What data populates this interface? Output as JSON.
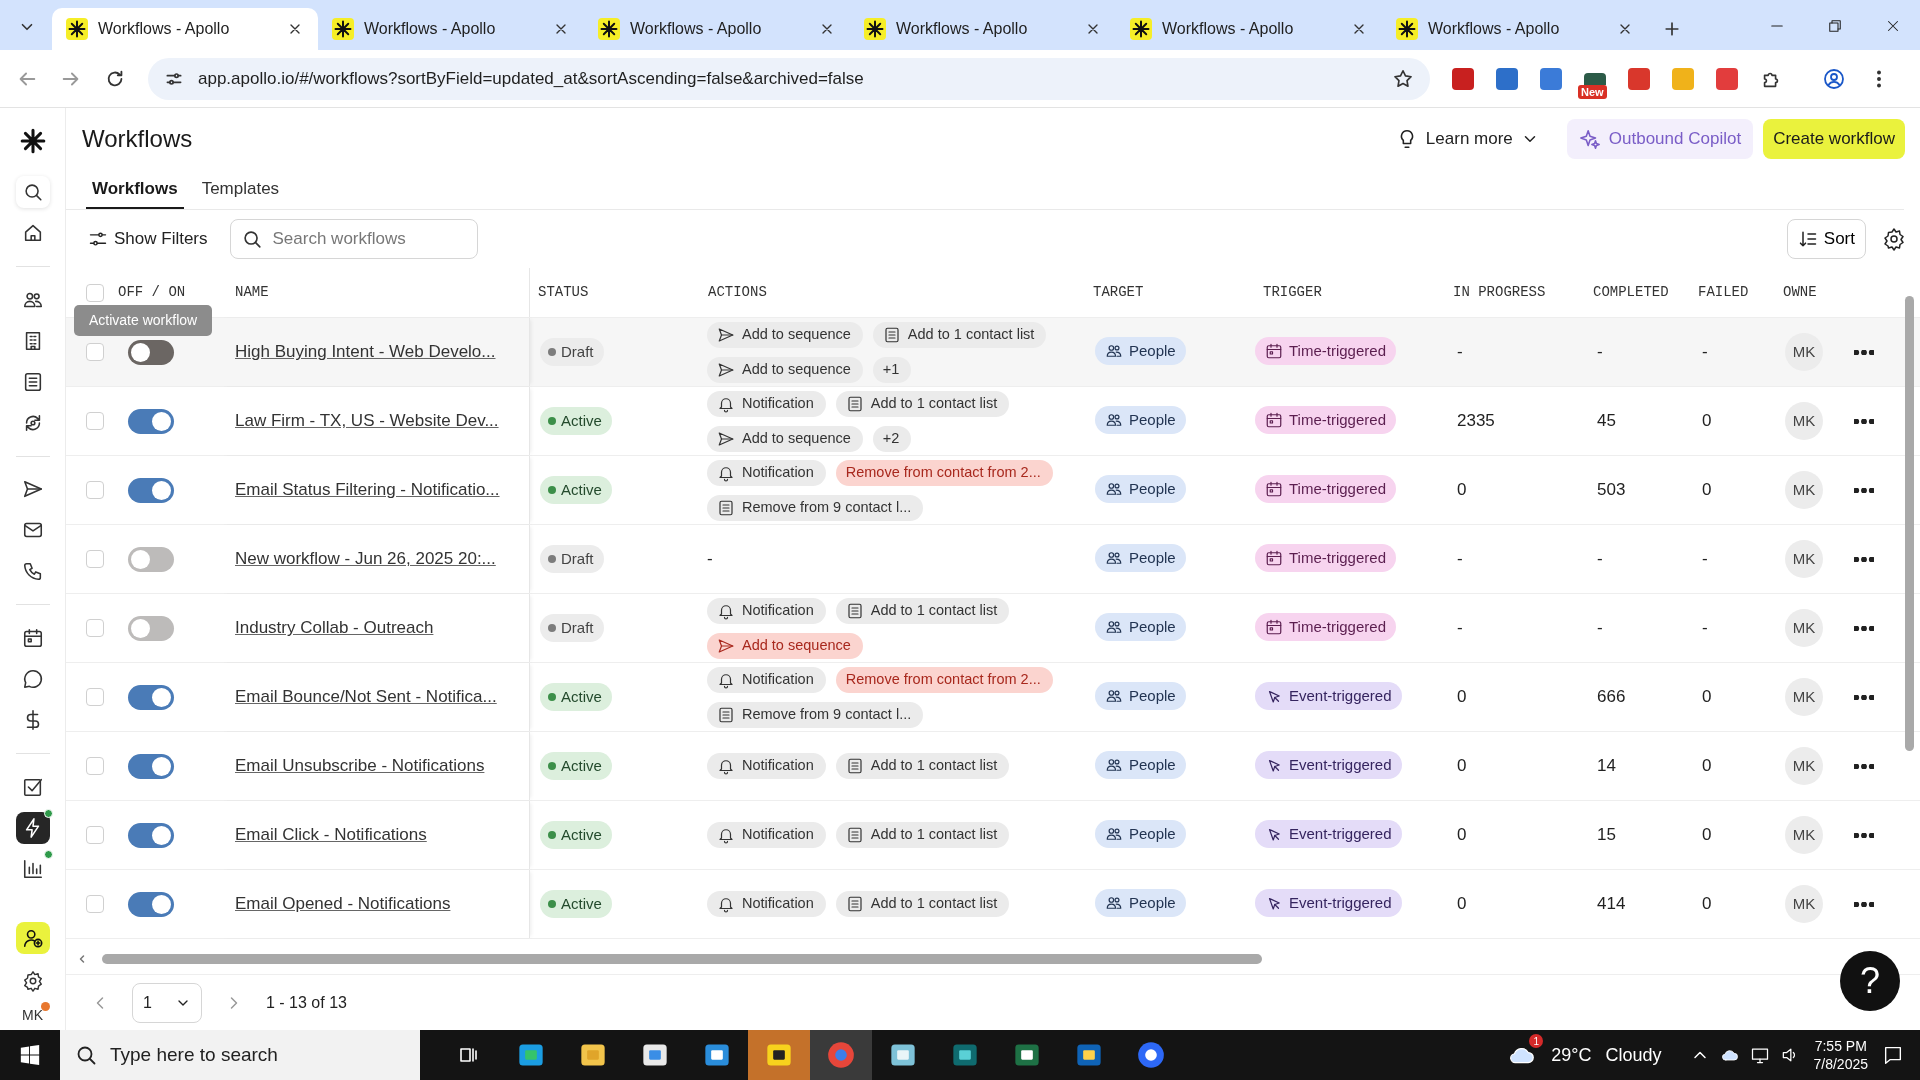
{
  "browser": {
    "tabs": [
      {
        "title": "Workflows - Apollo",
        "selected": true
      },
      {
        "title": "Workflows - Apollo",
        "selected": false
      },
      {
        "title": "Workflows - Apollo",
        "selected": false
      },
      {
        "title": "Workflows - Apollo",
        "selected": false
      },
      {
        "title": "Workflows - Apollo",
        "selected": false
      },
      {
        "title": "Workflows - Apollo",
        "selected": false
      }
    ],
    "url": "app.apollo.io/#/workflows?sortByField=updated_at&sortAscending=false&archived=false",
    "extension_badge": "New"
  },
  "sidebar": {
    "items": [
      {
        "selected": false,
        "dot": false
      },
      {
        "selected": false,
        "dot": false
      },
      {
        "selected": false,
        "dot": false
      },
      {
        "selected": false,
        "dot": false
      },
      {
        "selected": false,
        "dot": false
      },
      {
        "selected": false,
        "dot": false
      },
      {
        "selected": false,
        "dot": false
      },
      {
        "selected": false,
        "dot": false
      },
      {
        "selected": false,
        "dot": false
      },
      {
        "selected": false,
        "dot": false
      },
      {
        "selected": false,
        "dot": false
      },
      {
        "selected": false,
        "dot": false
      },
      {
        "selected": false,
        "dot": false
      },
      {
        "selected": true,
        "dot": true
      },
      {
        "selected": false,
        "dot": true
      }
    ],
    "avatar": {
      "initials": "MK",
      "dot": true
    }
  },
  "header": {
    "title": "Workflows",
    "learn_more": "Learn more",
    "copilot": "Outbound Copilot",
    "create": "Create workflow"
  },
  "tabs": [
    {
      "label": "Workflows",
      "selected": true
    },
    {
      "label": "Templates",
      "selected": false
    }
  ],
  "toolbar": {
    "filters": "Show Filters",
    "search": {
      "placeholder": "Search workflows"
    },
    "sort": "Sort"
  },
  "tooltip": "Activate workflow",
  "table": {
    "select_all": {
      "checked": false
    },
    "columns": [
      "OFF / ON",
      "NAME",
      "STATUS",
      "ACTIONS",
      "TARGET",
      "TRIGGER",
      "IN PROGRESS",
      "COMPLETED",
      "FAILED",
      "OWNE"
    ],
    "rows": [
      {
        "checked": false,
        "on": false,
        "hovered": true,
        "name": "High Buying Intent - Web Develo...",
        "status": {
          "label": "Draft",
          "kind": "draft"
        },
        "actions": [
          [
            {
              "kind": "sequence",
              "label": "Add to sequence",
              "alert": false
            },
            {
              "kind": "list",
              "label": "Add to 1 contact list",
              "alert": false
            }
          ],
          [
            {
              "kind": "sequence",
              "label": "Add to sequence",
              "alert": false
            },
            {
              "kind": "more",
              "label": "+1",
              "alert": false
            }
          ]
        ],
        "target": "People",
        "trigger": {
          "label": "Time-triggered",
          "kind": "time"
        },
        "in_progress": "-",
        "completed": "-",
        "failed": "-",
        "owner": "MK"
      },
      {
        "checked": false,
        "on": true,
        "hovered": false,
        "name": "Law Firm - TX, US - Website Dev...",
        "status": {
          "label": "Active",
          "kind": "active"
        },
        "actions": [
          [
            {
              "kind": "notification",
              "label": "Notification",
              "alert": false
            },
            {
              "kind": "list",
              "label": "Add to 1 contact list",
              "alert": false
            }
          ],
          [
            {
              "kind": "sequence",
              "label": "Add to sequence",
              "alert": false
            },
            {
              "kind": "more",
              "label": "+2",
              "alert": false
            }
          ]
        ],
        "target": "People",
        "trigger": {
          "label": "Time-triggered",
          "kind": "time"
        },
        "in_progress": "2335",
        "completed": "45",
        "failed": "0",
        "owner": "MK"
      },
      {
        "checked": false,
        "on": true,
        "hovered": false,
        "name": "Email Status Filtering - Notificatio...",
        "status": {
          "label": "Active",
          "kind": "active"
        },
        "actions": [
          [
            {
              "kind": "notification",
              "label": "Notification",
              "alert": false
            },
            {
              "kind": "plain",
              "label": "Remove from contact from 2...",
              "alert": true
            }
          ],
          [
            {
              "kind": "list",
              "label": "Remove from 9 contact l...",
              "alert": false
            }
          ]
        ],
        "target": "People",
        "trigger": {
          "label": "Time-triggered",
          "kind": "time"
        },
        "in_progress": "0",
        "completed": "503",
        "failed": "0",
        "owner": "MK"
      },
      {
        "checked": false,
        "on": false,
        "hovered": false,
        "name": "New workflow - Jun 26, 2025 20:...",
        "status": {
          "label": "Draft",
          "kind": "draft"
        },
        "actions_empty": "-",
        "target": "People",
        "trigger": {
          "label": "Time-triggered",
          "kind": "time"
        },
        "in_progress": "-",
        "completed": "-",
        "failed": "-",
        "owner": "MK"
      },
      {
        "checked": false,
        "on": false,
        "hovered": false,
        "name": "Industry Collab - Outreach",
        "status": {
          "label": "Draft",
          "kind": "draft"
        },
        "actions": [
          [
            {
              "kind": "notification",
              "label": "Notification",
              "alert": false
            },
            {
              "kind": "list",
              "label": "Add to 1 contact list",
              "alert": false
            }
          ],
          [
            {
              "kind": "sequence",
              "label": "Add to sequence",
              "alert": true
            }
          ]
        ],
        "target": "People",
        "trigger": {
          "label": "Time-triggered",
          "kind": "time"
        },
        "in_progress": "-",
        "completed": "-",
        "failed": "-",
        "owner": "MK"
      },
      {
        "checked": false,
        "on": true,
        "hovered": false,
        "name": "Email Bounce/Not Sent - Notifica...",
        "status": {
          "label": "Active",
          "kind": "active"
        },
        "actions": [
          [
            {
              "kind": "notification",
              "label": "Notification",
              "alert": false
            },
            {
              "kind": "plain",
              "label": "Remove from contact from 2...",
              "alert": true
            }
          ],
          [
            {
              "kind": "list",
              "label": "Remove from 9 contact l...",
              "alert": false
            }
          ]
        ],
        "target": "People",
        "trigger": {
          "label": "Event-triggered",
          "kind": "event"
        },
        "in_progress": "0",
        "completed": "666",
        "failed": "0",
        "owner": "MK"
      },
      {
        "checked": false,
        "on": true,
        "hovered": false,
        "name": "Email Unsubscribe - Notifications",
        "status": {
          "label": "Active",
          "kind": "active"
        },
        "actions": [
          [
            {
              "kind": "notification",
              "label": "Notification",
              "alert": false
            },
            {
              "kind": "list",
              "label": "Add to 1 contact list",
              "alert": false
            }
          ]
        ],
        "target": "People",
        "trigger": {
          "label": "Event-triggered",
          "kind": "event"
        },
        "in_progress": "0",
        "completed": "14",
        "failed": "0",
        "owner": "MK"
      },
      {
        "checked": false,
        "on": true,
        "hovered": false,
        "name": "Email Click - Notifications",
        "status": {
          "label": "Active",
          "kind": "active"
        },
        "actions": [
          [
            {
              "kind": "notification",
              "label": "Notification",
              "alert": false
            },
            {
              "kind": "list",
              "label": "Add to 1 contact list",
              "alert": false
            }
          ]
        ],
        "target": "People",
        "trigger": {
          "label": "Event-triggered",
          "kind": "event"
        },
        "in_progress": "0",
        "completed": "15",
        "failed": "0",
        "owner": "MK"
      },
      {
        "checked": false,
        "on": true,
        "hovered": false,
        "name": "Email Opened - Notifications",
        "status": {
          "label": "Active",
          "kind": "active"
        },
        "actions": [
          [
            {
              "kind": "notification",
              "label": "Notification",
              "alert": false
            },
            {
              "kind": "list",
              "label": "Add to 1 contact list",
              "alert": false
            }
          ]
        ],
        "target": "People",
        "trigger": {
          "label": "Event-triggered",
          "kind": "event"
        },
        "in_progress": "0",
        "completed": "414",
        "failed": "0",
        "owner": "MK"
      }
    ]
  },
  "pagination": {
    "page": "1",
    "range": "1 - 13 of 13"
  },
  "help": "?",
  "taskbar": {
    "search": {
      "placeholder": "Type here to search"
    },
    "weather": {
      "badge": "1",
      "temp": "29°C",
      "condition": "Cloudy"
    },
    "time": "7:55 PM",
    "date": "7/8/2025"
  }
}
